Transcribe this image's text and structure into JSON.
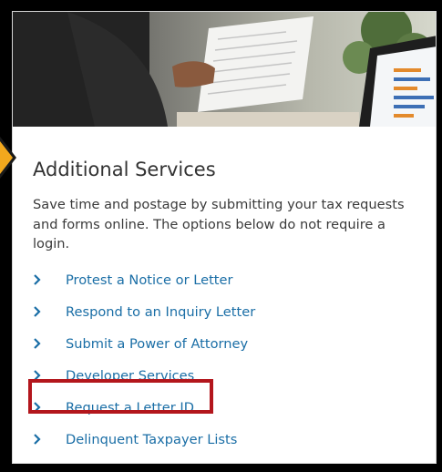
{
  "section": {
    "title": "Additional Services",
    "description": "Save time and postage by submitting your tax requests and forms online. The options below do not require a login."
  },
  "links": [
    {
      "label": "Protest a Notice or Letter"
    },
    {
      "label": "Respond to an Inquiry Letter"
    },
    {
      "label": "Submit a Power of Attorney"
    },
    {
      "label": "Developer Services"
    },
    {
      "label": "Request a Letter ID",
      "highlighted": true
    },
    {
      "label": "Delinquent Taxpayer Lists"
    }
  ],
  "icons": {
    "link_chevron": "chevron-right-icon",
    "callout_pointer": "arrow-pointer-icon"
  },
  "colors": {
    "link": "#1a6ea6",
    "highlight_box": "#b3161c",
    "pointer": "#f2a81d",
    "frame": "#000000"
  }
}
